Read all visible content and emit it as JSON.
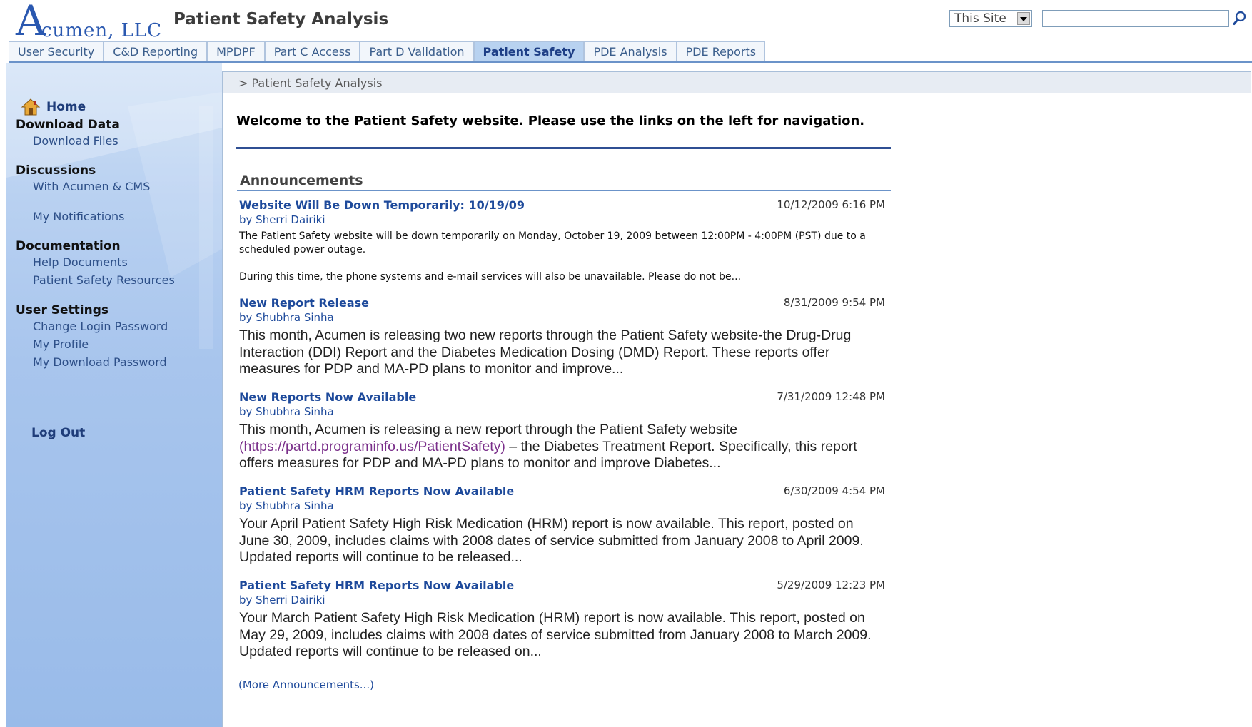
{
  "header": {
    "logo_big": "A",
    "logo_rest": "cumen, LLC",
    "site_title": "Patient Safety Analysis",
    "scope_selected": "This Site",
    "search_placeholder": ""
  },
  "tabs": [
    {
      "label": "User Security"
    },
    {
      "label": "C&D Reporting"
    },
    {
      "label": "MPDPF"
    },
    {
      "label": "Part C Access"
    },
    {
      "label": "Part D Validation"
    },
    {
      "label": "Patient Safety"
    },
    {
      "label": "PDE Analysis"
    },
    {
      "label": "PDE Reports"
    }
  ],
  "nav": {
    "home": "Home",
    "download_data": "Download Data",
    "download_files": "Download Files",
    "discussions": "Discussions",
    "with_acumen_cms": "With Acumen & CMS",
    "my_notifications": "My Notifications",
    "documentation": "Documentation",
    "help_documents": "Help Documents",
    "ps_resources": "Patient Safety Resources",
    "user_settings": "User Settings",
    "change_login_password": "Change Login Password",
    "my_profile": "My Profile",
    "my_download_password": "My Download Password",
    "log_out": "Log Out"
  },
  "main": {
    "breadcrumb": "> Patient Safety Analysis",
    "welcome": "Welcome to the Patient Safety website. Please use the links on the left for navigation.",
    "announcements_heading": "Announcements",
    "more": "(More Announcements...)"
  },
  "announcements": [
    {
      "title": "Website Will Be Down Temporarily: 10/19/09",
      "date": "10/12/2009 6:16 PM",
      "author": "by Sherri Dairiki",
      "body1": "The Patient Safety website will be down temporarily on Monday, October 19, 2009 between 12:00PM - 4:00PM (PST) due to a scheduled power outage.",
      "body2": "During this time, the phone systems and e-mail services will also be unavailable. Please do not be..."
    },
    {
      "title": "New Report Release",
      "date": "8/31/2009 9:54 PM",
      "author": "by Shubhra Sinha",
      "body": "This month, Acumen is releasing two new reports through the Patient Safety website-the Drug-Drug Interaction (DDI) Report and the Diabetes Medication Dosing (DMD) Report.  These reports offer measures for PDP and MA-PD plans to monitor and improve..."
    },
    {
      "title": "New Reports Now Available",
      "date": "7/31/2009 12:48 PM",
      "author": "by Shubhra Sinha",
      "body_pre": "This month, Acumen is releasing a new report through the Patient Safety website ",
      "body_link": "(https://partd.programinfo.us/PatientSafety)",
      "body_post": " – the Diabetes Treatment Report.  Specifically, this report offers measures for PDP and MA-PD plans to monitor and improve Diabetes..."
    },
    {
      "title": "Patient Safety HRM Reports Now Available",
      "date": "6/30/2009 4:54 PM",
      "author": "by Shubhra Sinha",
      "body": "Your April Patient Safety High Risk Medication (HRM) report is now available.  This report, posted on June 30, 2009, includes claims with 2008 dates of service submitted from January 2008 to April 2009.  Updated reports will continue to be released..."
    },
    {
      "title": "Patient Safety HRM Reports Now Available",
      "date": "5/29/2009 12:23 PM",
      "author": "by Sherri Dairiki",
      "body": "Your March Patient Safety High Risk Medication (HRM) report is now available.  This report, posted on May 29, 2009, includes claims with 2008 dates of service submitted from January 2008 to March 2009.  Updated reports will continue to be released on..."
    }
  ],
  "colors": {
    "accent": "#1e4a9b",
    "nav_bg": "#a8c5ed",
    "tab_active": "#b8d2f0"
  }
}
